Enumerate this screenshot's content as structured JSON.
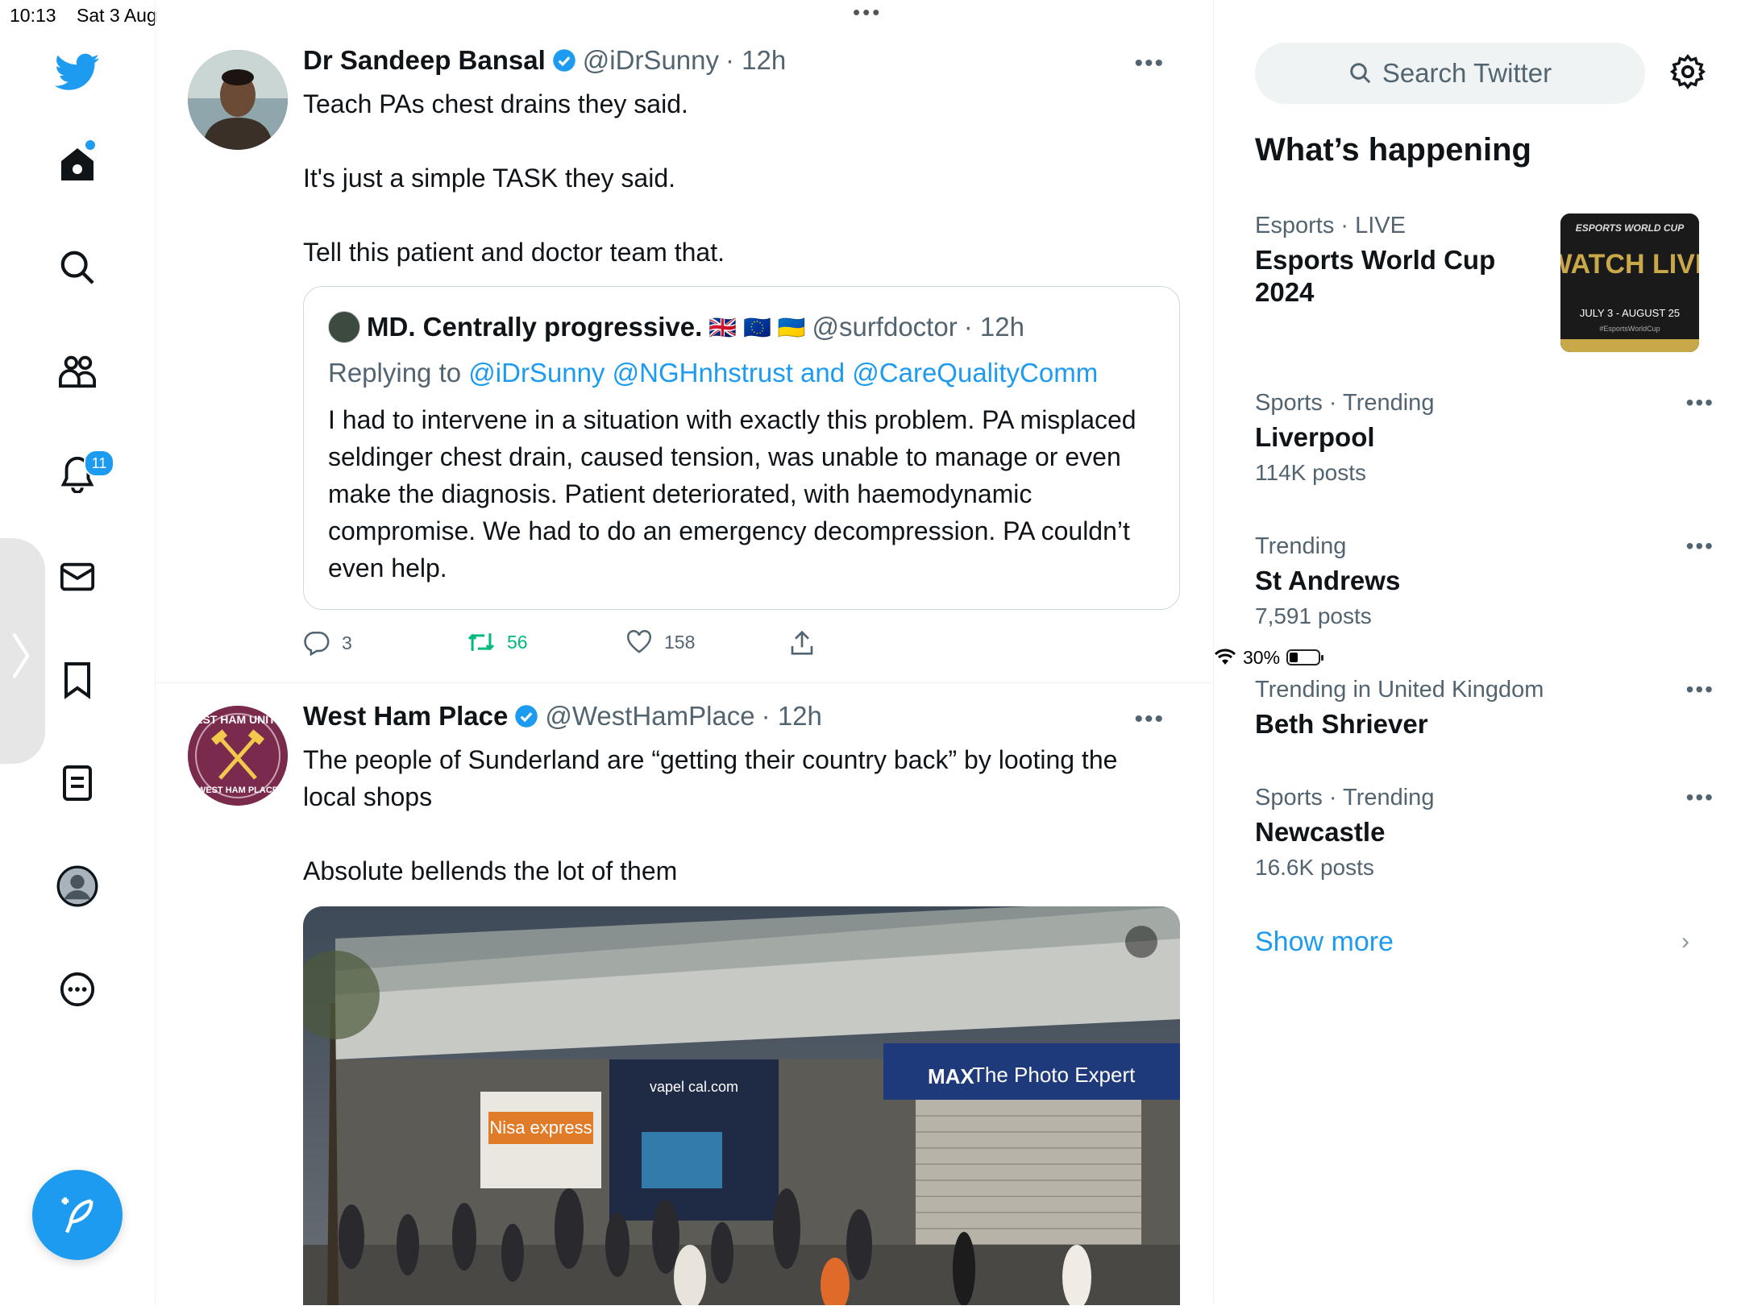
{
  "status_bar": {
    "time": "10:13",
    "date": "Sat 3 Aug",
    "battery": "30%",
    "battery_level": 0.3
  },
  "nav": {
    "notifications_badge": "11",
    "items": [
      "home-icon",
      "search-icon",
      "communities-icon",
      "notifications-icon",
      "messages-icon",
      "bookmarks-icon",
      "lists-icon",
      "profile-icon",
      "more-icon"
    ]
  },
  "tweets": [
    {
      "name": "Dr Sandeep Bansal",
      "handle": "@iDrSunny",
      "time": "· 12h",
      "text": "Teach PAs chest drains they said.\n\nIt's just a simple TASK they said.\n\nTell this patient and doctor team that.",
      "quote": {
        "name": "MD. Centrally progressive.",
        "flags": "🇬🇧 🇪🇺 🇺🇦",
        "handle": "@surfdoctor",
        "time": "· 12h",
        "replying_prefix": "Replying to",
        "mentions": "@iDrSunny @NGHnhstrust and @CareQualityComm",
        "text": "I had to intervene in a situation with exactly this problem. PA misplaced seldinger chest drain, caused tension, was unable to manage or even make the diagnosis. Patient deteriorated, with haemodynamic compromise. We had to do an emergency decompression. PA couldn’t even help."
      },
      "replies": "3",
      "retweets": "56",
      "likes": "158"
    },
    {
      "name": "West Ham Place",
      "handle": "@WestHamPlace",
      "time": "· 12h",
      "text": "The people of Sunderland are “getting their country back” by looting the local shops\n\nAbsolute bellends the lot of them",
      "avatar_text": "WEST HAM UNITED",
      "avatar_subtext": "WEST HAM PLACE",
      "media_signs": [
        "MAX",
        "The Photo Expert",
        "vapel cal.com",
        "Nisa express"
      ]
    }
  ],
  "sidebar": {
    "search_placeholder": "Search Twitter",
    "heading": "What’s happening",
    "trends": [
      {
        "meta": "Esports · LIVE",
        "title": "Esports World Cup 2024",
        "posts": ""
      },
      {
        "meta": "Sports · Trending",
        "title": "Liverpool",
        "posts": "114K posts"
      },
      {
        "meta": "Trending",
        "title": "St Andrews",
        "posts": "7,591 posts"
      },
      {
        "meta": "Trending in United Kingdom",
        "title": "Beth Shriever",
        "posts": ""
      },
      {
        "meta": "Sports · Trending",
        "title": "Newcastle",
        "posts": "16.6K posts"
      }
    ],
    "esports_image": {
      "line1": "ESPORTS WORLD CUP",
      "line2": "WATCH LIVE",
      "line3": "JULY 3 - AUGUST 25",
      "line4": "#EsportsWorldCup"
    },
    "show_more": "Show more"
  },
  "colors": {
    "accent": "#1d9bf0",
    "retweet": "#00ba7c",
    "muted": "#536471"
  }
}
